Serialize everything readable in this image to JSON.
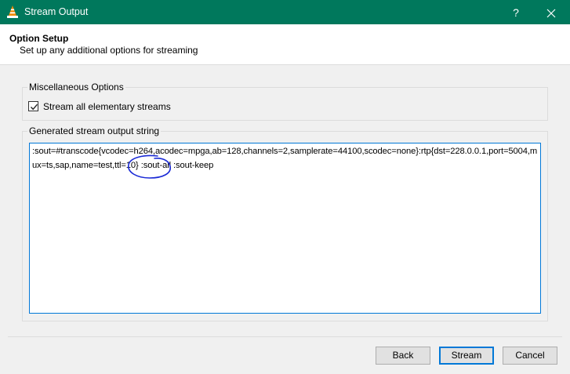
{
  "window": {
    "title": "Stream Output",
    "help_label": "?",
    "close_label": "✕",
    "titlebar_color": "#00785c"
  },
  "header": {
    "heading": "Option Setup",
    "subheading": "Set up any additional options for streaming"
  },
  "misc_options": {
    "legend": "Miscellaneous Options",
    "stream_all": {
      "label": "Stream all elementary streams",
      "checked": true
    }
  },
  "generated": {
    "legend": "Generated stream output string",
    "value": ":sout=#transcode{vcodec=h264,acodec=mpga,ab=128,channels=2,samplerate=44100,scodec=none}:rtp{dst=228.0.0.1,port=5004,mux=ts,sap,name=test,ttl=10} :sout-all :sout-keep",
    "annotation_color": "#1a2ad6"
  },
  "buttons": {
    "back": "Back",
    "stream": "Stream",
    "cancel": "Cancel"
  },
  "icons": {
    "app": "vlc-cone-icon",
    "checkbox": "checkmark-icon"
  }
}
